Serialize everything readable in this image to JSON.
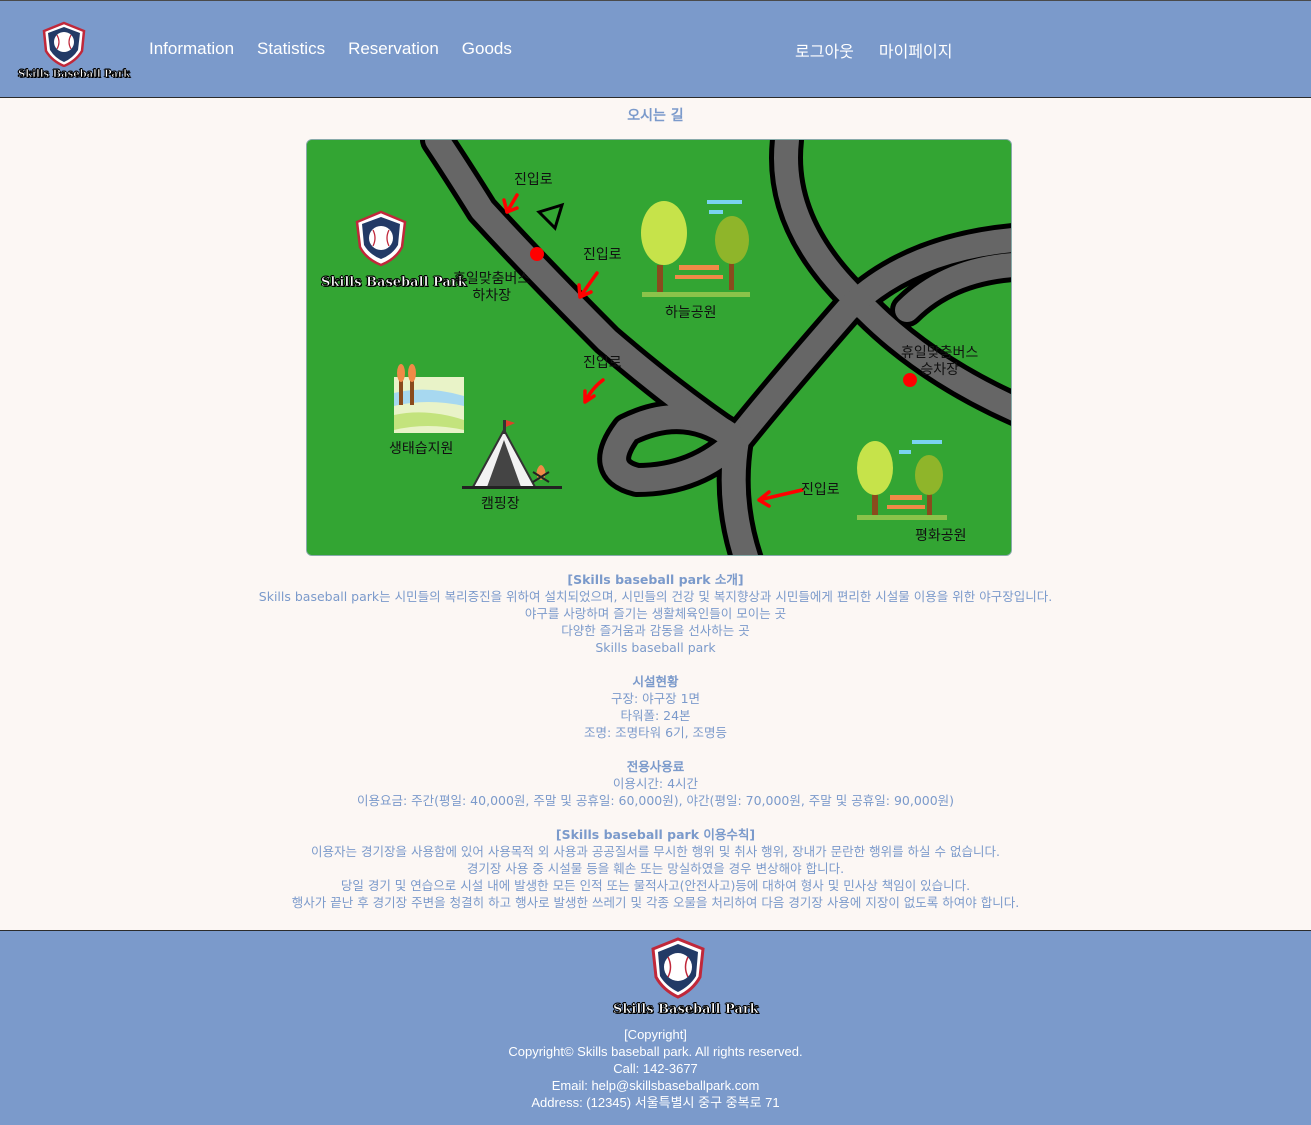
{
  "header": {
    "logo_text": "Skills Baseball Park",
    "nav": [
      "Information",
      "Statistics",
      "Reservation",
      "Goods"
    ],
    "nav_right": [
      "로그아웃",
      "마이페이지"
    ]
  },
  "main": {
    "title": "오시는 길",
    "map": {
      "logo_text": "Skills Baseball Park",
      "labels": {
        "entrance_1": "진입로",
        "entrance_2": "진입로",
        "entrance_3": "진입로",
        "entrance_4": "진입로",
        "bus_dropoff": "휴일맞춤버스\n하차장",
        "bus_pickup": "휴일맞춤버스\n승차장",
        "sky_park": "하늘공원",
        "peace_park": "평화공원",
        "wetland": "생태습지원",
        "camping": "캠핑장"
      }
    },
    "intro": {
      "title": "[Skills baseball park 소개]",
      "lines": [
        "Skills baseball park는 시민들의 복리증진을 위하여 설치되었으며, 시민들의 건강 및 복지향상과 시민들에게 편리한 시설물 이용을 위한 야구장입니다.",
        "야구를 사랑하며 즐기는 생활체육인들이 모이는 곳",
        "다양한 즐거움과 감동을 선사하는 곳",
        "Skills baseball park"
      ]
    },
    "facilities": {
      "title": "시설현황",
      "lines": [
        "구장: 야구장 1면",
        "타워폴: 24본",
        "조명: 조명타워 6기, 조명등"
      ]
    },
    "fees": {
      "title": "전용사용료",
      "lines": [
        "이용시간: 4시간",
        "이용요금: 주간(평일: 40,000원, 주말 및 공휴일: 60,000원), 야간(평일: 70,000원, 주말 및 공휴일: 90,000원)"
      ]
    },
    "rules": {
      "title": "[Skills baseball park 이용수칙]",
      "lines": [
        "이용자는 경기장을 사용함에 있어 사용목적 외 사용과 공공질서를 무시한 행위 및 취사 행위, 장내가 문란한 행위를 하실 수 없습니다.",
        "경기장 사용 중 시설물 등을 훼손 또는 망실하였을 경우 변상해야 합니다.",
        "당일 경기 및 연습으로 시설 내에 발생한 모든 인적 또는 물적사고(안전사고)등에 대하여 형사 및 민사상 책임이 있습니다.",
        "행사가 끝난 후 경기장 주변을 청결히 하고 행사로 발생한 쓰레기 및 각종 오물을 처리하여 다음 경기장 사용에 지장이 없도록 하여야 합니다."
      ]
    }
  },
  "footer": {
    "logo_text": "Skills Baseball Park",
    "lines": [
      "[Copyright]",
      "Copyright© Skills baseball park. All rights reserved.",
      "Call: 142-3677",
      "Email: help@skillsbaseballpark.com",
      "Address: (12345) 서울특별시 중구 중복로 71"
    ]
  },
  "colors": {
    "primary": "#7b9acb",
    "background": "#fcf7f4",
    "map_green": "#33a533",
    "road": "#666666"
  }
}
